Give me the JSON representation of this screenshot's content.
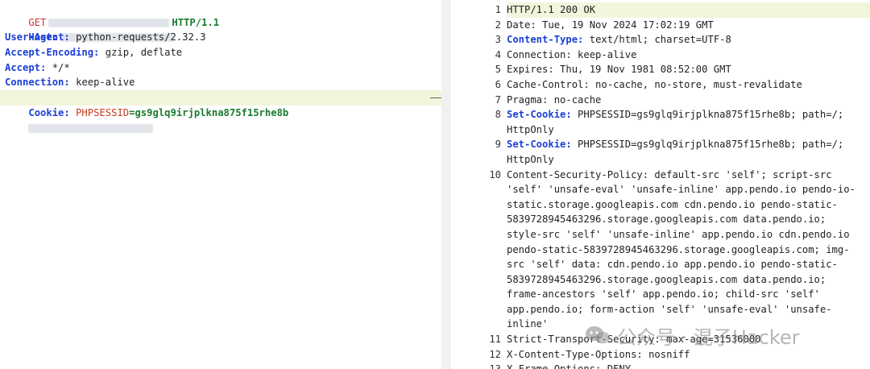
{
  "request": {
    "method": "GET",
    "protocol": "HTTP/1.1",
    "host_label": "Host:",
    "headers": [
      {
        "key": "User-Agent:",
        "value": "python-requests/2.32.3"
      },
      {
        "key": "Accept-Encoding:",
        "value": "gzip, deflate"
      },
      {
        "key": "Accept:",
        "value": "*/*"
      },
      {
        "key": "Connection:",
        "value": "keep-alive"
      }
    ],
    "cookie_key": "Cookie:",
    "cookie_name": "PHPSESSID",
    "cookie_eq": "=",
    "cookie_value": "gs9glq9irjplkna875f15rhe8b"
  },
  "response": {
    "lines": [
      {
        "n": "1",
        "text": "HTTP/1.1 200 OK"
      },
      {
        "n": "2",
        "text": "Date: Tue, 19 Nov 2024 17:02:19 GMT"
      },
      {
        "n": "3",
        "key": "Content-Type:",
        "text": " text/html; charset=UTF-8"
      },
      {
        "n": "4",
        "text": "Connection: keep-alive"
      },
      {
        "n": "5",
        "text": "Expires: Thu, 19 Nov 1981 08:52:00 GMT"
      },
      {
        "n": "6",
        "text": "Cache-Control: no-cache, no-store, must-revalidate"
      },
      {
        "n": "7",
        "text": "Pragma: no-cache"
      },
      {
        "n": "8",
        "key": "Set-Cookie:",
        "text": " PHPSESSID=gs9glq9irjplkna875f15rhe8b; path=/; HttpOnly"
      },
      {
        "n": "9",
        "key": "Set-Cookie:",
        "text": " PHPSESSID=gs9glq9irjplkna875f15rhe8b; path=/; HttpOnly"
      },
      {
        "n": "10",
        "text": "Content-Security-Policy: default-src 'self'; script-src 'self' 'unsafe-eval' 'unsafe-inline' app.pendo.io pendo-io-static.storage.googleapis.com cdn.pendo.io pendo-static-5839728945463296.storage.googleapis.com data.pendo.io; style-src 'self' 'unsafe-inline' app.pendo.io cdn.pendo.io pendo-static-5839728945463296.storage.googleapis.com; img-src 'self' data: cdn.pendo.io app.pendo.io pendo-static-5839728945463296.storage.googleapis.com data.pendo.io; frame-ancestors 'self' app.pendo.io; child-src 'self' app.pendo.io; form-action 'self' 'unsafe-eval' 'unsafe-inline'"
      },
      {
        "n": "11",
        "text": "Strict-Transport-Security: max-age=31536000"
      },
      {
        "n": "12",
        "text": "X-Content-Type-Options: nosniff"
      },
      {
        "n": "13",
        "text": "X-Frame-Options: DENY"
      }
    ]
  },
  "watermark": {
    "text": "公众号 · 混子Hacker"
  },
  "colors": {
    "highlight": "#f2f5dc",
    "keyword_blue": "#1c3fd6",
    "method_red": "#d0342c",
    "green": "#1a7a2e"
  }
}
